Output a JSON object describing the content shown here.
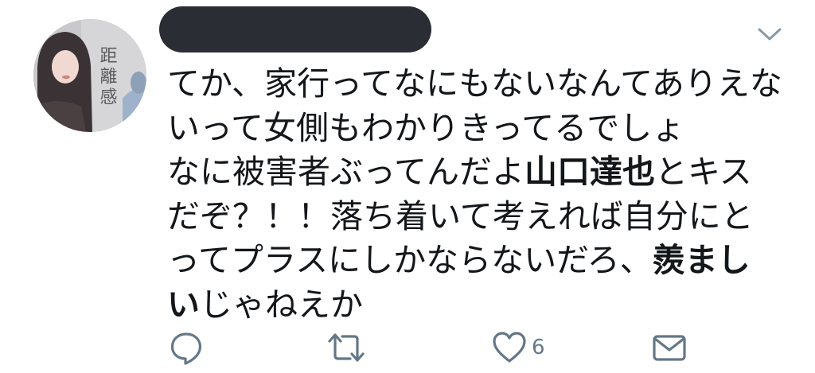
{
  "tweet": {
    "author": {
      "avatar_text": "距離感",
      "name_redacted": true
    },
    "text_lines": [
      [
        {
          "t": "てか、家行ってなにもないなんてありえな",
          "b": false
        }
      ],
      [
        {
          "t": "いって女側もわかりきってるでしょ",
          "b": false
        }
      ],
      [
        {
          "t": "なに被害者ぶってんだよ",
          "b": false
        },
        {
          "t": "山口達也",
          "b": true
        },
        {
          "t": "とキス",
          "b": false
        }
      ],
      [
        {
          "t": "だぞ？！！落ち着いて考えれば自分にと",
          "b": false
        }
      ],
      [
        {
          "t": "ってプラスにしかならないだろ、",
          "b": false
        },
        {
          "t": "羨まし",
          "b": true
        }
      ],
      [
        {
          "t": "い",
          "b": true
        },
        {
          "t": "じゃねえか",
          "b": false
        }
      ]
    ],
    "actions": {
      "reply_icon": "reply-icon",
      "retweet_icon": "retweet-icon",
      "like_icon": "heart-icon",
      "like_count": "6",
      "dm_icon": "envelope-icon"
    },
    "colors": {
      "text": "#14171a",
      "icon": "#657786",
      "redaction": "#2a2d33"
    }
  }
}
